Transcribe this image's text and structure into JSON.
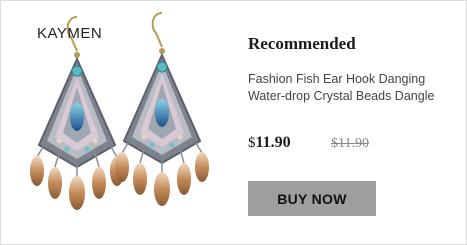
{
  "product": {
    "brand": "KAYMEN",
    "title": "Recommended",
    "description_line1": "Fashion Fish Ear Hook Danging",
    "description_line2": "Water-drop Crystal Beads Dangle",
    "currency": "$",
    "price": "11.90",
    "old_price": "$11.90",
    "buy_label": "BUY NOW"
  },
  "colors": {
    "button_bg": "#9e9e9e",
    "crystal": "#c58c5a",
    "turquoise": "#5bb9c4",
    "silver": "#8b8f97"
  }
}
